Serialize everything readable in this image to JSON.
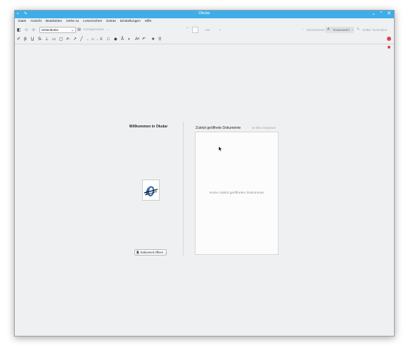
{
  "window": {
    "title": "Okular"
  },
  "menu": [
    "Datei",
    "Ansicht",
    "Bearbeiten",
    "Gehe zu",
    "Lesezeichen",
    "Extras",
    "Einstellungen",
    "Hilfe"
  ],
  "toolbar": {
    "zoom_value": "Seitenbreite",
    "view_mode": "Anzeigemodus",
    "page_of": "von",
    "browse": "Durchsuchen",
    "text_select": "Textauswahl",
    "highlighter": "Gelber Textmarker"
  },
  "welcome": {
    "title": "Willkommen in Okular",
    "open_button": "Dokument öffnen …"
  },
  "recent": {
    "title": "Zuletzt geöffnete Dokumente",
    "forget_all": "Alles vergessen",
    "empty": "Keine zuletzt geöffneten Dokumente"
  },
  "colors": {
    "titlebar": "#3daee9",
    "window_bg": "#eff0f1",
    "alert": "#da4453"
  },
  "icons": [
    "okular-logo-icon",
    "open-document-icon",
    "search-icon",
    "pin-icon"
  ]
}
